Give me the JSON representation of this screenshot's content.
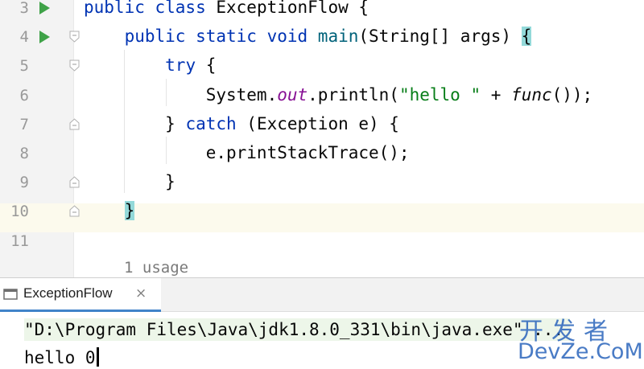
{
  "editor": {
    "lines": [
      {
        "num": "3",
        "run": true,
        "fold": false,
        "current": false,
        "tokens": [
          {
            "t": "public class ",
            "c": "kw"
          },
          {
            "t": "ExceptionFlow {",
            "c": ""
          }
        ]
      },
      {
        "num": "4",
        "run": true,
        "fold": "open",
        "current": false,
        "tokens": [
          {
            "t": "    ",
            "c": ""
          },
          {
            "t": "public static void ",
            "c": "kw"
          },
          {
            "t": "main",
            "c": "fn"
          },
          {
            "t": "(String[] args) ",
            "c": ""
          },
          {
            "t": "{",
            "c": "brace-hl"
          }
        ]
      },
      {
        "num": "5",
        "run": false,
        "fold": "open",
        "current": false,
        "tokens": [
          {
            "t": "        ",
            "c": ""
          },
          {
            "t": "try ",
            "c": "kw"
          },
          {
            "t": "{",
            "c": ""
          }
        ]
      },
      {
        "num": "6",
        "run": false,
        "fold": false,
        "current": false,
        "tokens": [
          {
            "t": "            System.",
            "c": ""
          },
          {
            "t": "out",
            "c": "fld"
          },
          {
            "t": ".println(",
            "c": ""
          },
          {
            "t": "\"hello \"",
            "c": "str"
          },
          {
            "t": " + ",
            "c": ""
          },
          {
            "t": "func",
            "c": "ital"
          },
          {
            "t": "());",
            "c": ""
          }
        ]
      },
      {
        "num": "7",
        "run": false,
        "fold": "close",
        "current": false,
        "tokens": [
          {
            "t": "        } ",
            "c": ""
          },
          {
            "t": "catch ",
            "c": "kw"
          },
          {
            "t": "(Exception e) {",
            "c": ""
          }
        ]
      },
      {
        "num": "8",
        "run": false,
        "fold": false,
        "current": false,
        "tokens": [
          {
            "t": "            e.printStackTrace();",
            "c": ""
          }
        ]
      },
      {
        "num": "9",
        "run": false,
        "fold": "close",
        "current": false,
        "tokens": [
          {
            "t": "        }",
            "c": ""
          }
        ]
      },
      {
        "num": "10",
        "run": false,
        "fold": "close",
        "current": true,
        "tokens": [
          {
            "t": "    ",
            "c": ""
          },
          {
            "t": "}",
            "c": "brace-hl"
          }
        ]
      },
      {
        "num": "11",
        "run": false,
        "fold": false,
        "current": false,
        "tokens": []
      }
    ],
    "usage_hint": "1 usage"
  },
  "run_window": {
    "tab_label": "ExceptionFlow",
    "tab_close": "×",
    "command_line": "\"D:\\Program Files\\Java\\jdk1.8.0_331\\bin\\java.exe\" ...",
    "output_line": "hello 0"
  },
  "watermark": {
    "cn": "开发者",
    "en": "DevZe.CoM"
  },
  "colors": {
    "keyword": "#0033b3",
    "method": "#00627a",
    "string": "#067d17",
    "field": "#871094",
    "run_icon": "#3fa248",
    "tab_underline": "#4083c9",
    "brace_highlight": "#93d9d9"
  }
}
